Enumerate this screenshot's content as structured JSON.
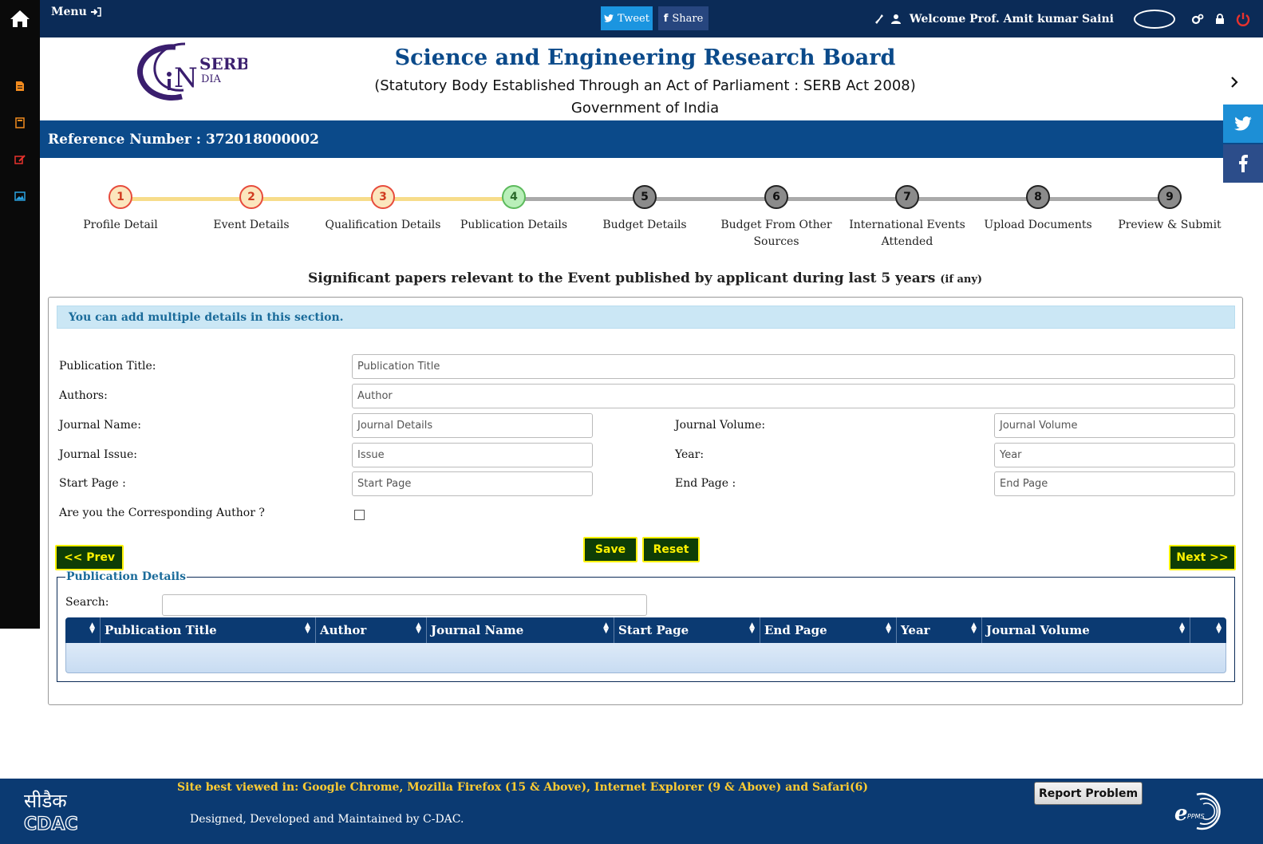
{
  "topbar": {
    "menu_label": "Menu",
    "tweet_label": "Tweet",
    "share_label": "Share",
    "welcome": "Welcome Prof. Amit kumar Saini"
  },
  "header": {
    "logo_text_1": "SERB",
    "logo_text_2": "DIA",
    "logo_text_3": "N",
    "title": "Science and Engineering Research Board",
    "subtitle": "(Statutory Body Established Through an Act of Parliament : SERB Act 2008)",
    "gov": "Government of India"
  },
  "reference": "Reference Number : 372018000002",
  "steps": [
    {
      "num": "1",
      "label": "Profile Detail",
      "state": "done"
    },
    {
      "num": "2",
      "label": "Event Details",
      "state": "done"
    },
    {
      "num": "3",
      "label": "Qualification Details",
      "state": "done"
    },
    {
      "num": "4",
      "label": "Publication Details",
      "state": "active"
    },
    {
      "num": "5",
      "label": "Budget Details",
      "state": "todo"
    },
    {
      "num": "6",
      "label": "Budget From Other Sources",
      "state": "todo"
    },
    {
      "num": "7",
      "label": "International Events Attended",
      "state": "todo"
    },
    {
      "num": "8",
      "label": "Upload Documents",
      "state": "todo"
    },
    {
      "num": "9",
      "label": "Preview & Submit",
      "state": "todo"
    }
  ],
  "section": {
    "title": "Significant papers relevant to the Event published by applicant during last 5 years",
    "title_note": "(if any)"
  },
  "form": {
    "info": "You can add multiple details in this section.",
    "pub_title_label": "Publication Title:",
    "pub_title_ph": "Publication Title",
    "authors_label": "Authors:",
    "authors_ph": "Author",
    "journal_name_label": "Journal Name:",
    "journal_name_ph": "Journal Details",
    "journal_volume_label": "Journal Volume:",
    "journal_volume_ph": "Journal Volume",
    "journal_issue_label": "Journal Issue:",
    "journal_issue_ph": "Issue",
    "year_label": "Year:",
    "year_ph": "Year",
    "start_page_label": "Start Page :",
    "start_page_ph": "Start Page",
    "end_page_label": "End Page :",
    "end_page_ph": "End Page",
    "corresponding_label": "Are you the Corresponding Author ?",
    "prev_label": "<< Prev",
    "save_label": "Save",
    "reset_label": "Reset",
    "next_label": "Next >>"
  },
  "table": {
    "legend": "Publication Details",
    "search_label": "Search:",
    "columns": [
      "Publication Title",
      "Author",
      "Journal Name",
      "Start Page",
      "End Page",
      "Year",
      "Journal Volume"
    ]
  },
  "footer": {
    "cdac_hindi": "सीडैक",
    "cdac": "CDAC",
    "best_viewed": "Site best viewed in: Google Chrome, Mozilla Firefox (15 & Above), Internet Explorer (9 & Above) and Safari(6)",
    "designed": "Designed, Developed and Maintained by C-DAC.",
    "report": "Report Problem",
    "eppms_1": "e",
    "eppms_2": "PPMS"
  }
}
